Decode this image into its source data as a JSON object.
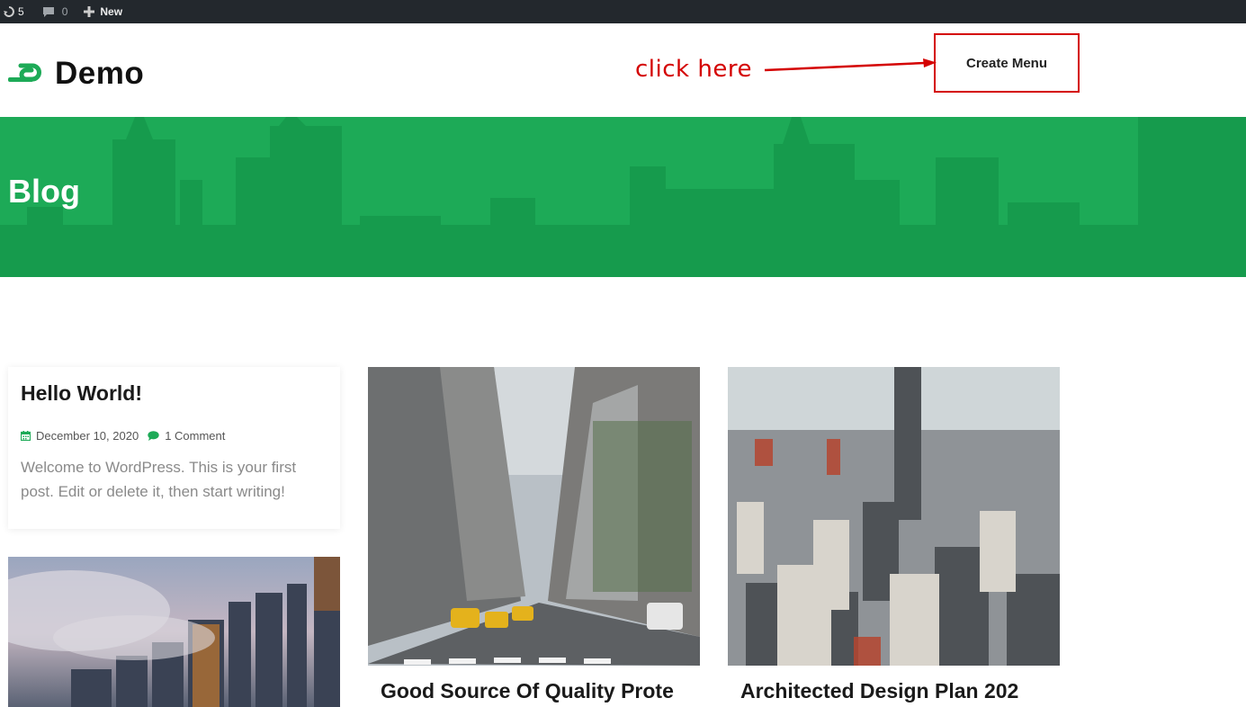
{
  "adminbar": {
    "updates_count": "5",
    "comments_count": "0",
    "new_label": "New"
  },
  "header": {
    "site_title": "Demo",
    "annotation_text": "click here",
    "create_menu_label": "Create Menu"
  },
  "banner": {
    "title": "Blog"
  },
  "posts": [
    {
      "title": "Hello World!",
      "date": "December 10, 2020",
      "comments": "1 Comment",
      "excerpt": "Welcome to WordPress. This is your first post. Edit or delete it, then start writing!"
    },
    {
      "title": "Good Source Of Quality Prote"
    },
    {
      "title": "Architected Design Plan 202"
    }
  ],
  "colors": {
    "accent": "#1daa57",
    "annotation": "#d40000",
    "adminbar": "#23282d"
  }
}
